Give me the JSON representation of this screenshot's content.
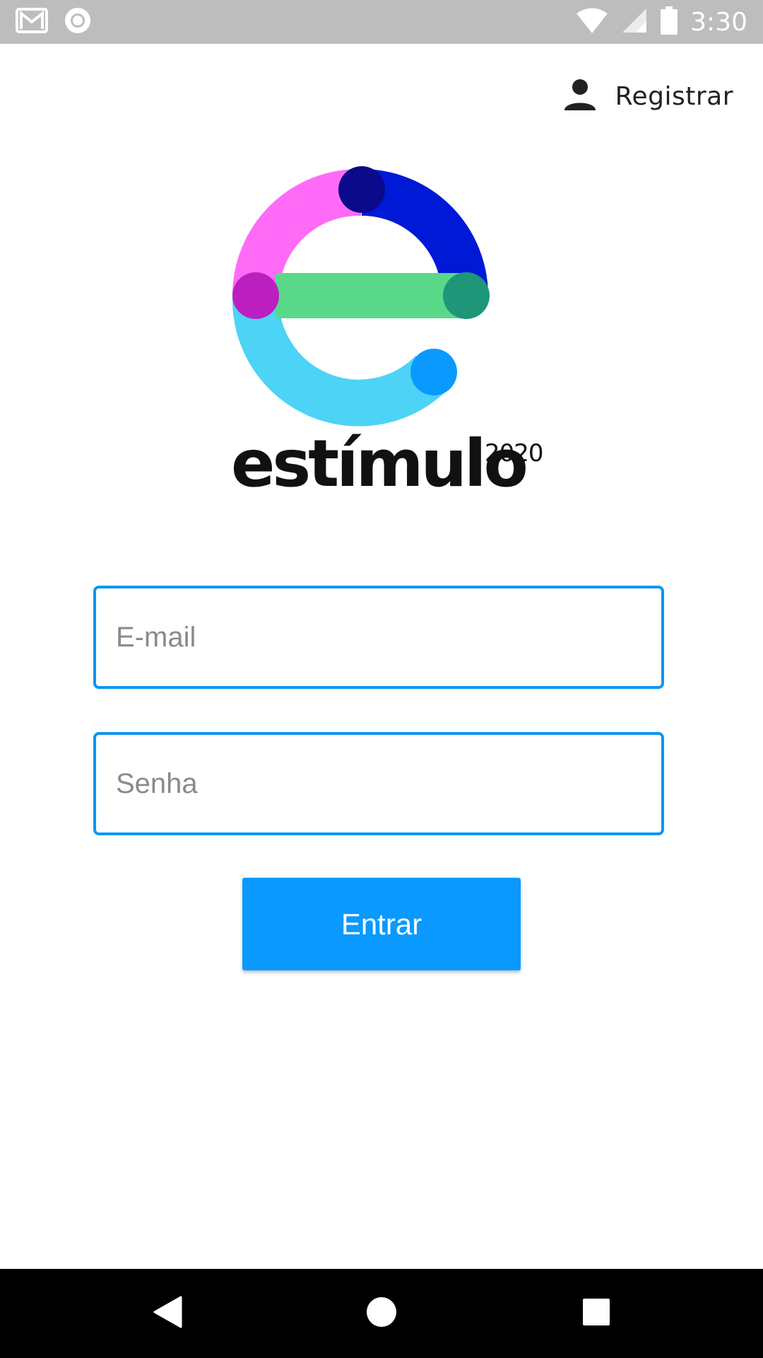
{
  "status_bar": {
    "time": "3:30",
    "icons": [
      "gmail-icon",
      "record-icon",
      "wifi-icon",
      "signal-icon",
      "battery-icon"
    ]
  },
  "header": {
    "register_label": "Registrar",
    "register_icon": "person-icon"
  },
  "logo": {
    "wordmark": "estímulo",
    "superscript": "2020",
    "colors": {
      "pink": "#ff6bf7",
      "navy": "#0a0a8a",
      "blue": "#0019d6",
      "green": "#5ad88a",
      "teal": "#1e9678",
      "magenta": "#bb1fc0",
      "cyan": "#4dd3f5",
      "sky": "#0a99ff"
    }
  },
  "form": {
    "email_placeholder": "E-mail",
    "password_placeholder": "Senha",
    "submit_label": "Entrar"
  },
  "nav_bar": {
    "icons": [
      "back-icon",
      "home-icon",
      "recents-icon"
    ]
  },
  "colors": {
    "accent": "#0a99ff",
    "field_border": "#0b96f2",
    "status_bar": "#bdbdbd"
  }
}
